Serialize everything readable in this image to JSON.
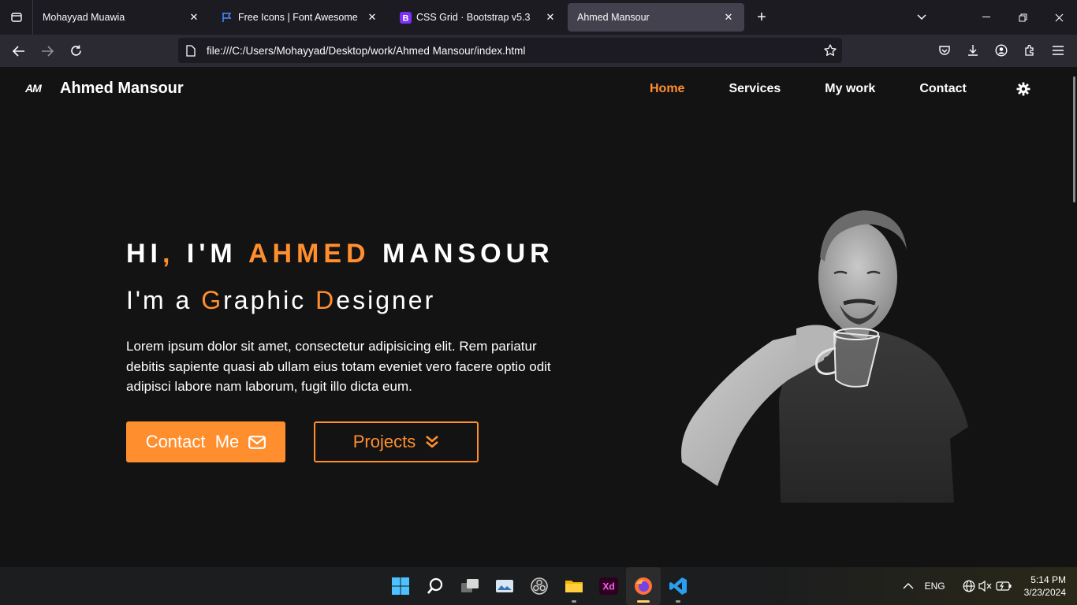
{
  "browser": {
    "tabs": [
      {
        "title": "Mohayyad Muawia",
        "favicon": "none"
      },
      {
        "title": "Free Icons | Font Awesome",
        "favicon": "flag-icon"
      },
      {
        "title": "CSS Grid · Bootstrap v5.3",
        "favicon": "bootstrap-icon"
      },
      {
        "title": "Ahmed Mansour",
        "favicon": "none",
        "active": true
      }
    ],
    "url": "file:///C:/Users/Mohayyad/Desktop/work/Ahmed Mansour/index.html"
  },
  "site": {
    "logo": "AM",
    "brand": "Ahmed Mansour",
    "menu": {
      "home": "Home",
      "services": "Services",
      "work": "My work",
      "contact": "Contact"
    },
    "hero": {
      "hi": "Hi",
      "comma": ",",
      "im": " I'M ",
      "first": "Ahmed",
      "last": " Mansour",
      "sub_prefix": "I'm a ",
      "sub_g": "G",
      "sub_raphic": "raphic ",
      "sub_d": "D",
      "sub_esigner": "esigner",
      "text": "Lorem ipsum dolor sit amet, consectetur adipisicing elit. Rem pariatur debitis sapiente quasi ab ullam eius totam eveniet vero facere optio odit adipisci labore nam laborum, fugit illo dicta eum.",
      "contact_btn": "Contact  Me",
      "projects_btn": "Projects"
    },
    "accent_color": "#ff8f2e"
  },
  "taskbar": {
    "language": "ENG",
    "time": "5:14 PM",
    "date": "3/23/2024"
  }
}
